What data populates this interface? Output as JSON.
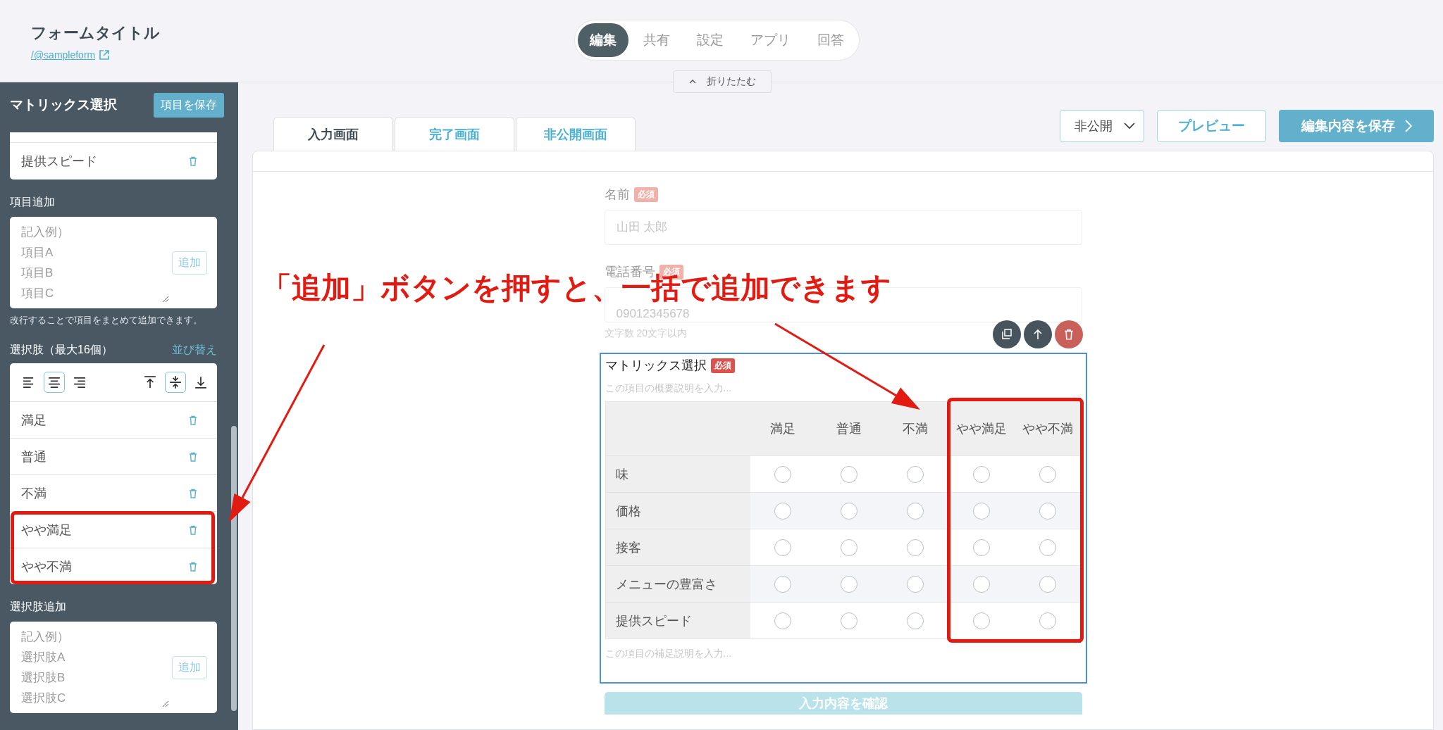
{
  "header": {
    "title": "フォームタイトル",
    "link": "/@sampleform"
  },
  "nav_tabs": [
    {
      "label": "編集",
      "selected": true
    },
    {
      "label": "共有",
      "selected": false
    },
    {
      "label": "設定",
      "selected": false
    },
    {
      "label": "アプリ",
      "selected": false
    },
    {
      "label": "回答",
      "selected": false
    }
  ],
  "collapse_button": "折りたたむ",
  "sidebar": {
    "title": "マトリックス選択",
    "save_button": "項目を保存",
    "item_rows": [
      "提供スピード"
    ],
    "item_add": {
      "label": "項目追加",
      "placeholder": [
        "記入例）",
        "項目A",
        "項目B",
        "項目C"
      ],
      "button": "追加"
    },
    "hint": "改行することで項目をまとめて追加できます。",
    "choices": {
      "label": "選択肢（最大16個）",
      "sort_link": "並び替え",
      "align_buttons": [
        {
          "kind": "left",
          "selected": false
        },
        {
          "kind": "center",
          "selected": true
        },
        {
          "kind": "right",
          "selected": false
        }
      ],
      "valign_buttons": [
        {
          "kind": "top",
          "selected": false
        },
        {
          "kind": "middle",
          "selected": true
        },
        {
          "kind": "bottom",
          "selected": false
        }
      ],
      "rows": [
        {
          "label": "満足",
          "highlighted": false
        },
        {
          "label": "普通",
          "highlighted": false
        },
        {
          "label": "不満",
          "highlighted": false
        },
        {
          "label": "やや満足",
          "highlighted": true
        },
        {
          "label": "やや不満",
          "highlighted": true
        }
      ]
    },
    "choice_add": {
      "label": "選択肢追加",
      "placeholder": [
        "記入例）",
        "選択肢A",
        "選択肢B",
        "選択肢C"
      ],
      "button": "追加"
    }
  },
  "screen_tabs": [
    {
      "label": "入力画面",
      "selected": true
    },
    {
      "label": "完了画面",
      "selected": false
    },
    {
      "label": "非公開画面",
      "selected": false
    }
  ],
  "toolbar": {
    "visibility": "非公開",
    "preview": "プレビュー",
    "save": "編集内容を保存"
  },
  "form": {
    "fields": [
      {
        "label": "名前",
        "badge": "必須",
        "placeholder": "山田 太郎"
      },
      {
        "label": "電話番号",
        "badge": "必須",
        "placeholder": "09012345678",
        "hint": "文字数 20文字以内"
      }
    ],
    "matrix": {
      "title": "マトリックス選択",
      "badge": "必須",
      "description_placeholder": "この項目の概要説明を入力...",
      "columns": [
        {
          "label": "満足",
          "highlighted": false
        },
        {
          "label": "普通",
          "highlighted": false
        },
        {
          "label": "不満",
          "highlighted": false
        },
        {
          "label": "やや満足",
          "highlighted": true
        },
        {
          "label": "やや不満",
          "highlighted": true
        }
      ],
      "rows": [
        {
          "label": "味",
          "cells": [
            {
              "checked": false
            },
            {
              "checked": false
            },
            {
              "checked": false
            },
            {
              "checked": false
            },
            {
              "checked": false
            }
          ]
        },
        {
          "label": "価格",
          "cells": [
            {
              "checked": false
            },
            {
              "checked": false
            },
            {
              "checked": false
            },
            {
              "checked": false
            },
            {
              "checked": false
            }
          ]
        },
        {
          "label": "接客",
          "cells": [
            {
              "checked": false
            },
            {
              "checked": false
            },
            {
              "checked": false
            },
            {
              "checked": false
            },
            {
              "checked": false
            }
          ]
        },
        {
          "label": "メニューの豊富さ",
          "cells": [
            {
              "checked": false
            },
            {
              "checked": false
            },
            {
              "checked": false
            },
            {
              "checked": false
            },
            {
              "checked": false
            }
          ]
        },
        {
          "label": "提供スピード",
          "cells": [
            {
              "checked": false
            },
            {
              "checked": false
            },
            {
              "checked": false
            },
            {
              "checked": false
            },
            {
              "checked": false
            }
          ]
        }
      ],
      "note_placeholder": "この項目の補足説明を入力..."
    },
    "submit": "入力内容を確認"
  },
  "annotation": "「追加」ボタンを押すと、一括で追加できます"
}
